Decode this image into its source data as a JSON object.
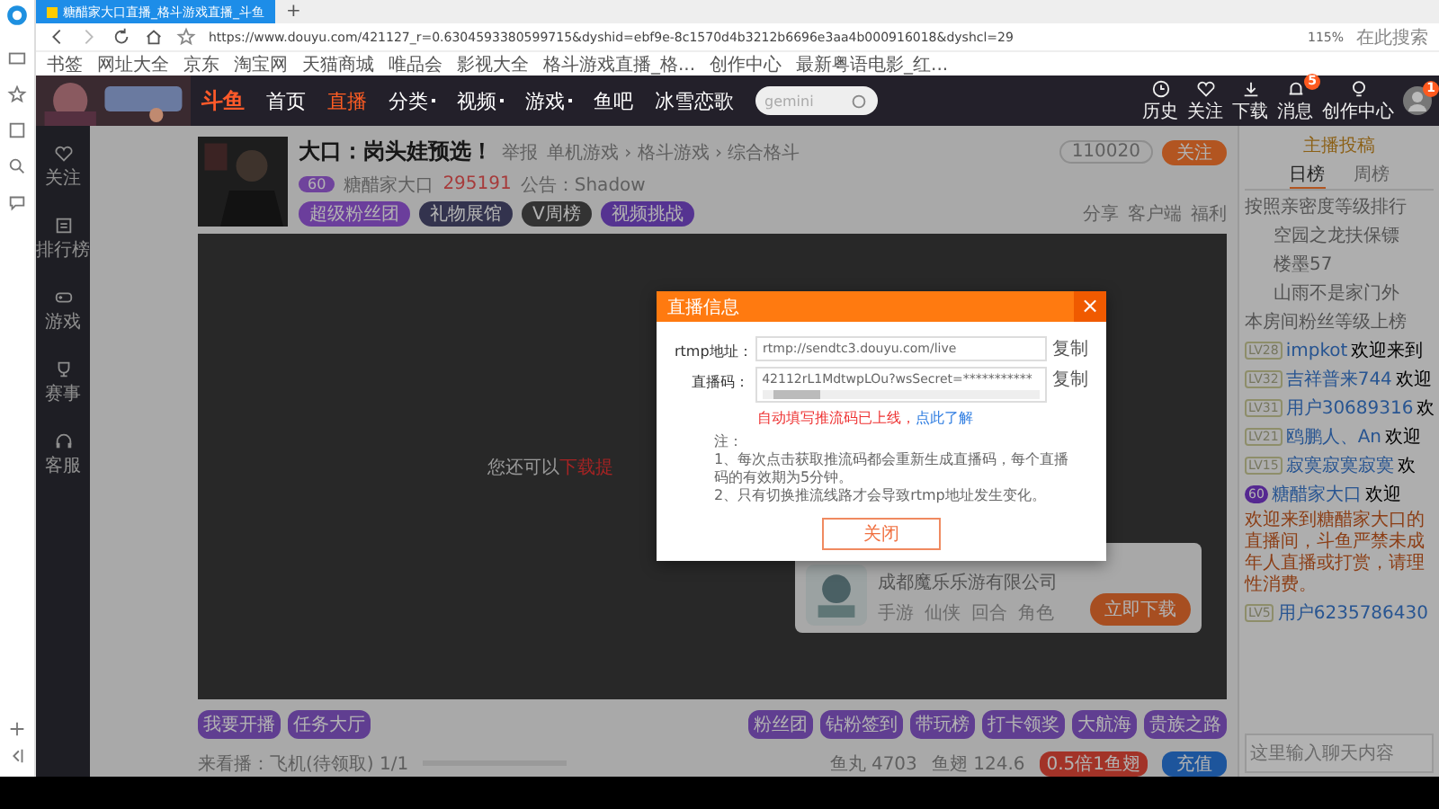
{
  "browser": {
    "tab": {
      "title": "糖醋家大口直播_格斗游戏直播_斗鱼"
    },
    "new_tab": "+",
    "url": "https://www.douyu.com/421127_r=0.6304593380599715&dyshid=ebf9e-8c1570d4b3212b6696e3aa4b000916018&dyshcl=29",
    "zoom": "115%",
    "search_placeholder": "在此搜索",
    "bookmarks": [
      "书签",
      "网址大全",
      "京东",
      "淘宝网",
      "天猫商城",
      "唯品会",
      "影视大全",
      "格斗游戏直播_格...",
      "创作中心",
      "最新粤语电影_红..."
    ]
  },
  "site": {
    "logo": "斗鱼",
    "search_placeholder": "gemini",
    "nav": [
      {
        "label": "首页",
        "selected": false,
        "dropdown": false
      },
      {
        "label": "直播",
        "selected": true,
        "dropdown": false
      },
      {
        "label": "分类",
        "selected": false,
        "dropdown": true
      },
      {
        "label": "视频",
        "selected": false,
        "dropdown": true
      },
      {
        "label": "游戏",
        "selected": false,
        "dropdown": true
      },
      {
        "label": "鱼吧",
        "selected": false,
        "dropdown": false
      },
      {
        "label": "冰雪恋歌",
        "selected": false,
        "dropdown": false
      }
    ],
    "actions": [
      {
        "label": "历史",
        "kind": "clock"
      },
      {
        "label": "关注",
        "kind": "heart"
      },
      {
        "label": "下载",
        "kind": "download"
      },
      {
        "label": "消息",
        "kind": "bell",
        "badge": "5"
      },
      {
        "label": "创作中心",
        "kind": "bulb"
      }
    ],
    "avatar_badge": "1"
  },
  "left_nav": [
    {
      "label": "关注",
      "kind": "heart"
    },
    {
      "label": "排行榜",
      "kind": "list"
    },
    {
      "label": "游戏",
      "kind": "game"
    },
    {
      "label": "赛事",
      "kind": "cup"
    },
    {
      "label": "客服",
      "kind": "headset"
    }
  ],
  "room": {
    "title": "大口：岗头娃预选！",
    "report": "举报",
    "breadcrumb": "单机游戏 › 格斗游戏 › 综合格斗",
    "level": "60",
    "anchor": "糖醋家大口",
    "hot": "295191",
    "notice": "公告：Shadow",
    "follow_count": "110020",
    "follow": "关注",
    "tags": [
      "超级粉丝团",
      "礼物展馆",
      "V周榜",
      "视频挑战"
    ],
    "actions": [
      "分享",
      "客户端",
      "福利"
    ]
  },
  "video": {
    "message": "您还可以",
    "link": "下载提"
  },
  "ad": {
    "company": "成都魔乐乐游有限公司",
    "tags": [
      "手游",
      "仙侠",
      "回合",
      "角色"
    ],
    "button": "立即下载"
  },
  "gifts_left": [
    "我要开播",
    "任务大厅"
  ],
  "gifts_right": [
    "粉丝团",
    "钻粉签到",
    "带玩榜",
    "打卡领奖",
    "大航海",
    "贵族之路"
  ],
  "status": {
    "task": {
      "label": "来看播：飞机(待领取) 1/1",
      "level": 0
    },
    "coins": "鱼丸 4703",
    "fins": "鱼翅 124.6",
    "rate": "0.5倍1鱼翅",
    "recharge": "充值"
  },
  "chat": {
    "title": "主播投稿",
    "tabs": [
      {
        "label": "日榜",
        "selected": true
      },
      {
        "label": "周榜",
        "selected": false
      }
    ],
    "rank_title": "按照亲密度等级排行",
    "ranks": [
      "空园之龙扶保镖",
      "楼墨57",
      "山雨不是家门外"
    ],
    "notice": "本房间粉丝等级上榜",
    "messages": [
      {
        "kind": "level",
        "badge": "LV28",
        "user": "impkot",
        "text": "欢迎来到"
      },
      {
        "kind": "level",
        "badge": "LV32",
        "user": "吉祥普来744",
        "text": "欢迎"
      },
      {
        "kind": "level",
        "badge": "LV31",
        "user": "用户30689316",
        "text": "欢"
      },
      {
        "kind": "level",
        "badge": "LV21",
        "user": "鸥鹏人、An",
        "text": "欢迎"
      },
      {
        "kind": "level",
        "badge": "LV15",
        "user": "寂寞寂寞寂寞",
        "text": "欢"
      },
      {
        "kind": "fan",
        "badge": "60",
        "user": "糖醋家大口",
        "text": "欢迎"
      }
    ],
    "system": "欢迎来到糖醋家大口的直播间，斗鱼严禁未成年人直播或打赏，请理性消费。",
    "last": {
      "kind": "level",
      "badge": "LV5",
      "user": "用户6235786430"
    },
    "input_placeholder": "这里输入聊天内容"
  },
  "modal": {
    "title": "直播信息",
    "close": "×",
    "rtmp_label": "rtmp地址：",
    "rtmp": "rtmp://sendtc3.douyu.com/live",
    "code_label": "直播码：",
    "code": "42112rL1MdtwpLOu?wsSecret=***********",
    "copy_rtmp": "复制",
    "copy_code": "复制",
    "hint": "自动填写推流码已上线，",
    "hint_link": "点此了解",
    "note_title": "注：",
    "notes": [
      "1、每次点击获取推流码都会重新生成直播码，每个直播码的有效期为5分钟。",
      "2、只有切换推流线路才会导致rtmp地址发生变化。"
    ],
    "button": "关闭"
  }
}
